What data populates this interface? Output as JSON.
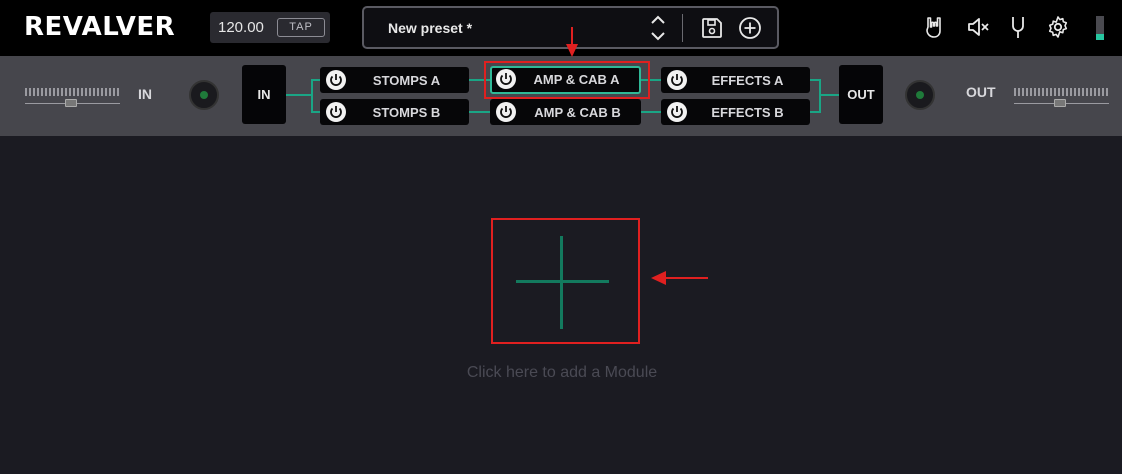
{
  "header": {
    "logo": "REVALVER",
    "tempo": {
      "value": "120.00",
      "tap_label": "TAP"
    },
    "preset": {
      "name": "New preset *"
    },
    "icons": [
      "rock-hand-icon",
      "speaker-mute-icon",
      "tuner-fork-icon",
      "gear-icon"
    ],
    "meter_level": 0.25
  },
  "routing": {
    "input": {
      "label": "IN",
      "node_label": "IN"
    },
    "output": {
      "label": "OUT",
      "node_label": "OUT"
    },
    "blocks": {
      "stomps_a": "STOMPS A",
      "stomps_b": "STOMPS B",
      "amp_cab_a": "AMP & CAB A",
      "amp_cab_b": "AMP & CAB B",
      "effects_a": "EFFECTS A",
      "effects_b": "EFFECTS B"
    },
    "active_block": "AMP & CAB A",
    "accent_color": "#1aa585"
  },
  "main": {
    "add_module_hint": "Click here to add a Module"
  },
  "annotation_color": "#e02020"
}
